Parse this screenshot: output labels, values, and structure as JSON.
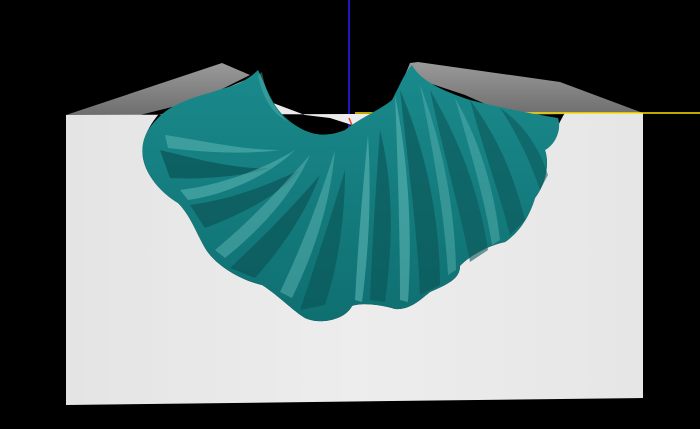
{
  "scene": {
    "background_color": "#000000",
    "block_front_color": "#e9e9e9",
    "block_top_color": "#8a8a8a",
    "surface_color": "#127a7c",
    "surface_highlight_color": "#5fb6b4",
    "surface_shadow_color": "#0b4e50",
    "axis_vertical_color": "#2222ff",
    "axis_horizontal_color": "#ffe000",
    "axis_accent_color": "#ff3b1e",
    "fold_count": 9
  }
}
